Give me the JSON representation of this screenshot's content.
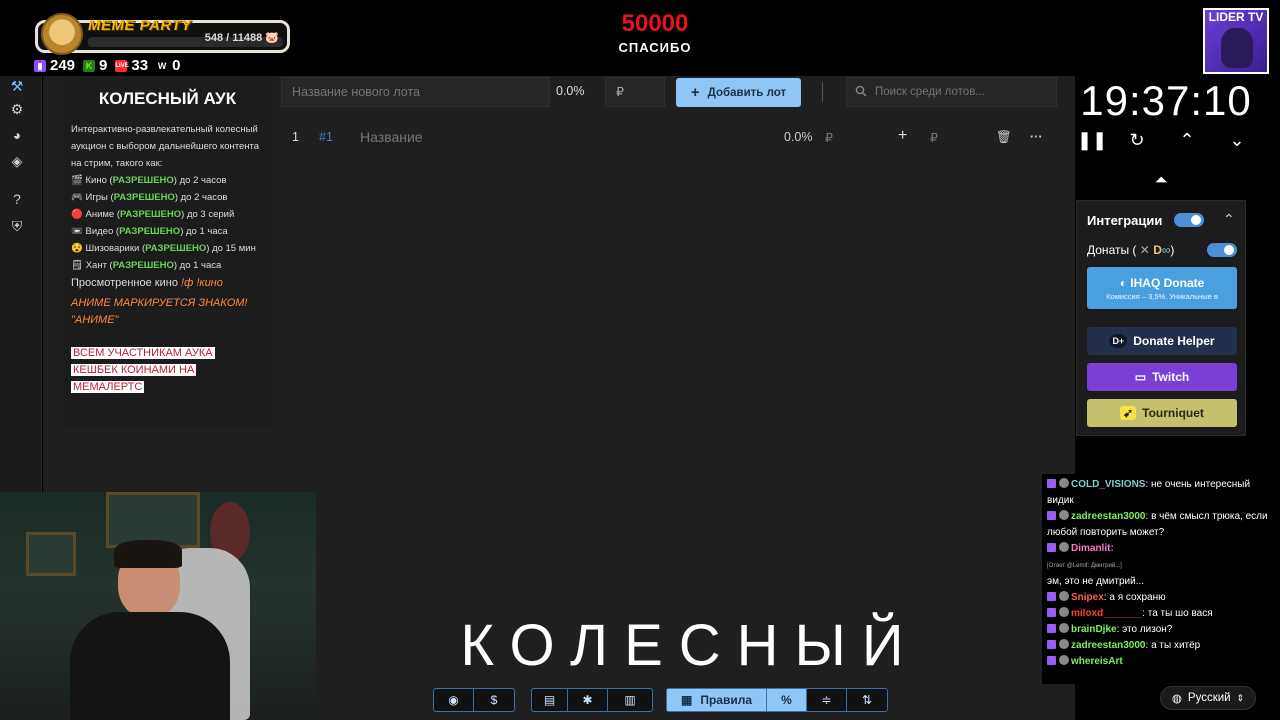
{
  "overlay": {
    "meme_title": "MEME PARTY",
    "meme_count": "548 / 11488",
    "counters": [
      {
        "icon": "twitch-icon",
        "value": "249",
        "color": "#9146ff"
      },
      {
        "icon": "kick-icon",
        "value": "9",
        "color": "#53fc18"
      },
      {
        "icon": "vk-live-icon",
        "value": "33",
        "color": "#ff2b2b"
      },
      {
        "icon": "w-icon",
        "value": "0",
        "color": "#ffffff"
      }
    ],
    "goal_number": "50000",
    "goal_label": "СПАСИБО",
    "badge_label": "LIDER TV"
  },
  "info": {
    "title": "КОЛЕСНЫЙ АУК",
    "description": "Интерактивно-развлекательный колесный аукцион с выбором дальнейшего контента на стрим, такого как:",
    "rules": [
      {
        "icon": "🎬",
        "name": "Кино",
        "status": "РАЗРЕШЕНО",
        "limit": "до 2 часов"
      },
      {
        "icon": "🎮",
        "name": "Игры",
        "status": "РАЗРЕШЕНО",
        "limit": "до 2 часов"
      },
      {
        "icon": "🔴",
        "name": "Аниме",
        "status": "РАЗРЕШЕНО",
        "limit": "до 3 серий"
      },
      {
        "icon": "📼",
        "name": "Видео",
        "status": "РАЗРЕШЕНО",
        "limit": "до 1 часа"
      },
      {
        "icon": "😵",
        "name": "Шизоварики",
        "status": "РАЗРЕШЕНО",
        "limit": "до 15 мин"
      },
      {
        "icon": "🗒",
        "name": "Хант",
        "status": "РАЗРЕШЕНО",
        "limit": "до 1 часа"
      }
    ],
    "watched_prefix": "Просмотренное кино",
    "watched_cmd": "!ф !кино",
    "anime_note": "АНИМЕ МАРКИРУЕТСЯ ЗНАКОМ! \"АНИМЕ\"",
    "cashback": [
      "ВСЕМ УЧАСТНИКАМ АУКА",
      "КЕШБЕК КОИНАМИ НА",
      "МЕМАЛЕРТС"
    ]
  },
  "lot_form": {
    "name_placeholder": "Название нового лота",
    "percent": "0.0%",
    "amount_placeholder": "₽",
    "add_label": "Добавить лот",
    "search_placeholder": "Поиск среди лотов..."
  },
  "lot_row": {
    "index": "1",
    "id": "#1",
    "name": "Название",
    "percent": "0.0%",
    "currency": "₽",
    "add": "+",
    "currency2": "₽"
  },
  "timer": {
    "value": "19:37:10"
  },
  "integrations": {
    "title": "Интеграции",
    "donations_label": "Донаты (",
    "donations_close": ")",
    "ihaq_label": "IHAQ Donate",
    "ihaq_sub": "Комиссия – 3,5%. Уникальные в",
    "donate_helper_label": "Donate Helper",
    "twitch_label": "Twitch",
    "tourniquet_label": "Tourniquet"
  },
  "chat": [
    {
      "nick": "COLD_VISIONS",
      "color": "#7fd0c8",
      "text": "не очень интересный видик"
    },
    {
      "nick": "zadreestan3000",
      "color": "#7cf25a",
      "text": "в чём смысл трюка, если любой повторить может?"
    },
    {
      "nick": "Dimanlit:",
      "color": "#ff77c8",
      "text": "",
      "reply": "[Ответ @Lemif: Дмитрий...]",
      "text2": "эм, это не дмитрий..."
    },
    {
      "nick": "Snipex",
      "color": "#ff5f5f",
      "text": "а я сохраню"
    },
    {
      "nick": "miloxd_______",
      "color": "#ff3b3b",
      "text": "та ты шо вася"
    },
    {
      "nick": "brainDjke",
      "color": "#7cf25a",
      "text": "это лизон?"
    },
    {
      "nick": "zadreestan3000",
      "color": "#7cf25a",
      "text": "а ты хитёр"
    },
    {
      "nick": "whereisArt",
      "color": "#7cf25a",
      "text": ""
    }
  ],
  "language": {
    "label": "Русский"
  },
  "subtitle": "КОЛЕСНЫЙ",
  "toolbar": {
    "rules_label": "Правила",
    "percent_label": "%"
  }
}
